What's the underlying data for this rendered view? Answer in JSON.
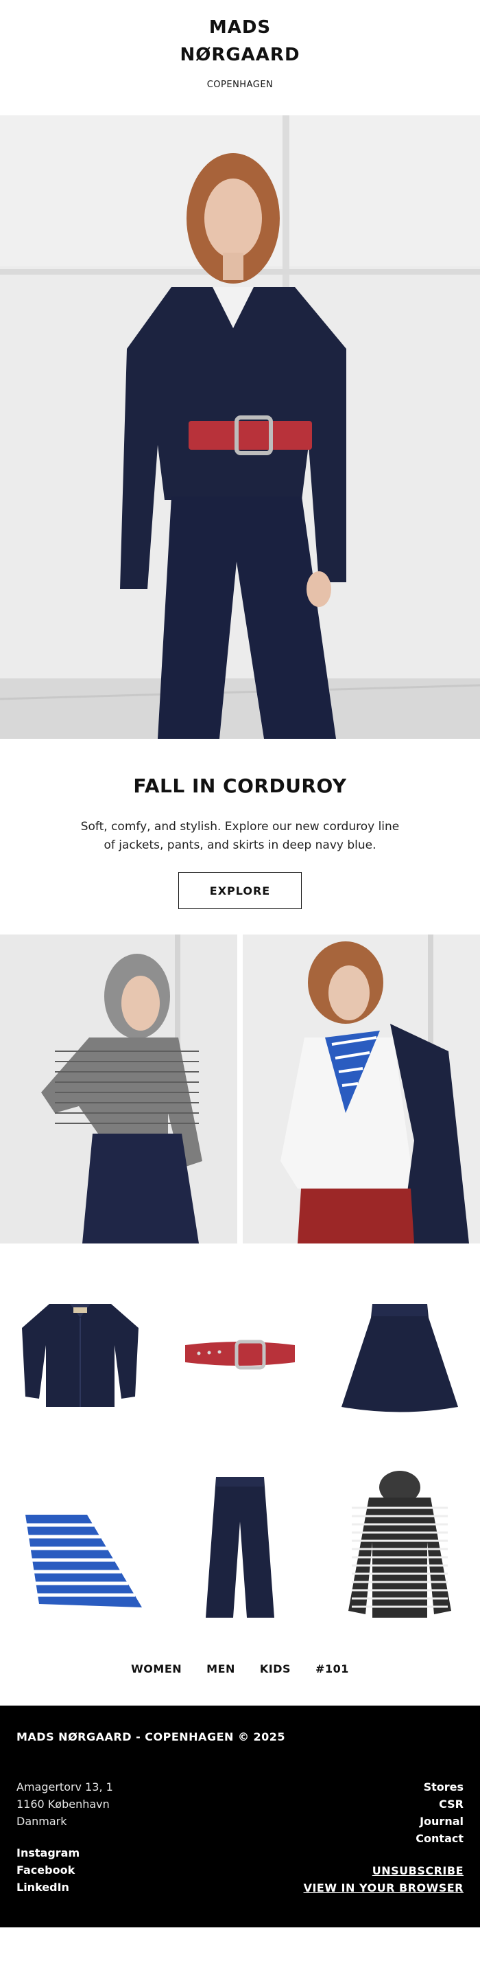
{
  "header": {
    "brand_line1": "MADS",
    "brand_line2": "NØRGAARD",
    "brand_sub": "COPENHAGEN"
  },
  "intro": {
    "title": "FALL IN CORDUROY",
    "body": "Soft, comfy, and stylish. Explore our new corduroy line of jackets, pants, and skirts in deep navy blue.",
    "button": "EXPLORE"
  },
  "nav": {
    "items": [
      "WOMEN",
      "MEN",
      "KIDS",
      "#101"
    ]
  },
  "footer": {
    "copyright": "MADS NØRGAARD - COPENHAGEN © 2025",
    "address": [
      "Amagertorv 13, 1",
      "1160 København",
      "Danmark"
    ],
    "social": [
      "Instagram",
      "Facebook",
      "LinkedIn"
    ],
    "links": [
      "Stores",
      "CSR",
      "Journal",
      "Contact"
    ],
    "unsubscribe": "UNSUBSCRIBE",
    "view_browser": "VIEW IN YOUR BROWSER"
  },
  "colors": {
    "navy": "#1c2340",
    "belt_red": "#b8323a",
    "stripe_blue": "#2a5cc0",
    "footer_bg": "#000000"
  }
}
